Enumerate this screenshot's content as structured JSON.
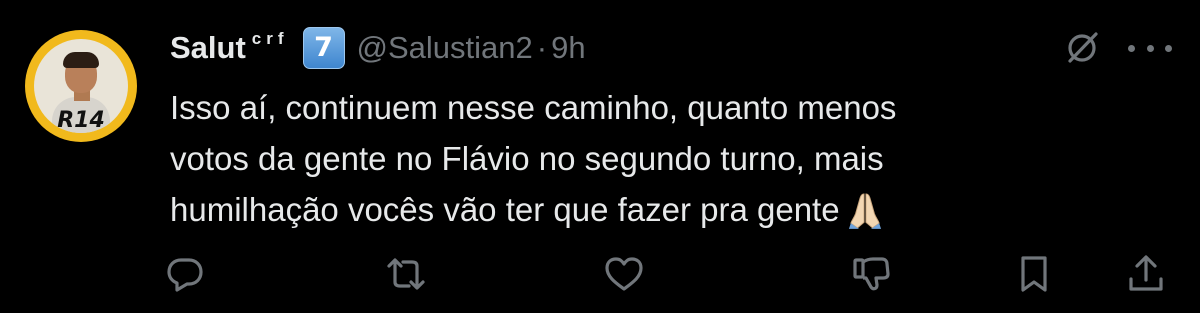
{
  "user": {
    "display_name": "Salut",
    "superscript": "crf",
    "badge": "7",
    "handle": "@Salustian2",
    "separator": "·",
    "time": "9h",
    "avatar_text": "R14"
  },
  "tweet": {
    "lines": [
      "Isso aí, continuem nesse caminho, quanto menos",
      "votos da gente no Flávio no segundo turno, mais",
      "humilhação vocês vão ter que fazer pra gente"
    ],
    "emoji": "folded-hands"
  },
  "icons": {
    "grok": "no-grok-icon",
    "more": "more-icon",
    "reply": "reply-icon",
    "retweet": "retweet-icon",
    "like": "like-icon",
    "dislike": "dislike-icon",
    "bookmark": "bookmark-icon",
    "share": "share-icon"
  },
  "colors": {
    "background": "#000000",
    "text": "#e7e9ea",
    "muted": "#71767b",
    "badge": "#4f93d6",
    "avatar_ring": "#f1b91c"
  }
}
